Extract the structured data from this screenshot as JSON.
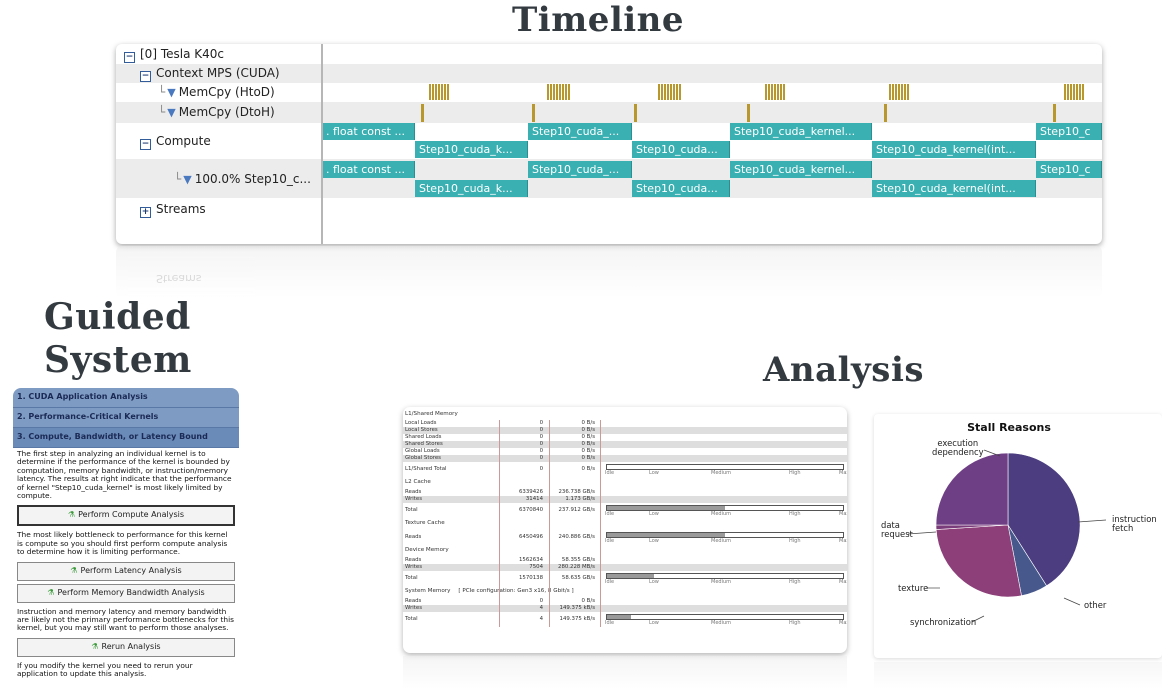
{
  "titles": {
    "timeline": "Timeline",
    "guided_line1": "Guided",
    "guided_line2": "System",
    "analysis": "Analysis"
  },
  "timeline": {
    "device": "[0] Tesla K40c",
    "context": "Context MPS (CUDA)",
    "memcpy_htod": "MemCpy (HtoD)",
    "memcpy_dtoh": "MemCpy (DtoH)",
    "compute": "Compute",
    "kernel_row": "100.0% Step10_c...",
    "streams": "Streams",
    "kernels_top": [
      ". float const ...",
      "Step10_cuda_...",
      "Step10_cuda_kernel...",
      "Step10_c"
    ],
    "kernels_bottom": [
      "Step10_cuda_k...",
      "Step10_cuda...",
      "Step10_cuda_kernel(int..."
    ]
  },
  "guided": {
    "sections": [
      "1. CUDA Application Analysis",
      "2. Performance-Critical Kernels",
      "3. Compute, Bandwidth, or Latency Bound"
    ],
    "intro": "The first step in analyzing an individual kernel is to determine if the performance of the kernel is bounded by computation, memory bandwidth, or instruction/memory latency. The results at right indicate that the performance of kernel \"Step10_cuda_kernel\" is most likely limited by compute.",
    "btn_compute": "Perform Compute Analysis",
    "compute_note": "The most likely bottleneck to performance for this kernel is compute so you should first perform compute analysis to determine how it is limiting performance.",
    "btn_latency": "Perform Latency Analysis",
    "btn_membw": "Perform Memory Bandwidth Analysis",
    "latency_note": "Instruction and memory latency and memory bandwidth are likely not the primary performance bottlenecks for this kernel, but you may still want to perform those analyses.",
    "btn_rerun": "Rerun Analysis",
    "rerun_note": "If you modify the kernel you need to rerun your application to update this analysis."
  },
  "metrics": {
    "sections": {
      "l1": "L1/Shared Memory",
      "l2": "L2 Cache",
      "tex": "Texture Cache",
      "dev": "Device Memory",
      "sys": "System Memory",
      "sys_note": "[ PCIe configuration: Gen3 x16, 8 Gbit/s ]"
    },
    "scale": [
      "Idle",
      "Low",
      "Medium",
      "High",
      "Max"
    ],
    "l1_rows": [
      {
        "name": "Local Loads",
        "count": "0",
        "rate": "0 B/s"
      },
      {
        "name": "Local Stores",
        "count": "0",
        "rate": "0 B/s"
      },
      {
        "name": "Shared Loads",
        "count": "0",
        "rate": "0 B/s"
      },
      {
        "name": "Shared Stores",
        "count": "0",
        "rate": "0 B/s"
      },
      {
        "name": "Global Loads",
        "count": "0",
        "rate": "0 B/s"
      },
      {
        "name": "Global Stores",
        "count": "0",
        "rate": "0 B/s"
      }
    ],
    "l1_total": {
      "name": "L1/Shared Total",
      "count": "0",
      "rate": "0 B/s",
      "level": 0.0
    },
    "l2_rows": [
      {
        "name": "Reads",
        "count": "6339426",
        "rate": "236.738 GB/s"
      },
      {
        "name": "Writes",
        "count": "31414",
        "rate": "1.173 GB/s"
      }
    ],
    "l2_total": {
      "name": "Total",
      "count": "6370840",
      "rate": "237.912 GB/s",
      "level": 0.5
    },
    "tex_reads": {
      "name": "Reads",
      "count": "6450496",
      "rate": "240.886 GB/s",
      "level": 0.5
    },
    "dev_rows": [
      {
        "name": "Reads",
        "count": "1562634",
        "rate": "58.355 GB/s"
      },
      {
        "name": "Writes",
        "count": "7504",
        "rate": "280.228 MB/s"
      }
    ],
    "dev_total": {
      "name": "Total",
      "count": "1570138",
      "rate": "58.635 GB/s",
      "level": 0.2
    },
    "sys_rows": [
      {
        "name": "Reads",
        "count": "0",
        "rate": "0 B/s"
      },
      {
        "name": "Writes",
        "count": "4",
        "rate": "149.375 kB/s"
      }
    ],
    "sys_total": {
      "name": "Total",
      "count": "4",
      "rate": "149.375 kB/s",
      "level": 0.1
    }
  },
  "stall": {
    "title": "Stall Reasons",
    "labels": {
      "execution_dependency": [
        "execution",
        "dependency"
      ],
      "instruction_fetch": [
        "instruction",
        "fetch"
      ],
      "data_request": [
        "data",
        "request"
      ],
      "texture": "texture",
      "other": "other",
      "synchronization": "synchronization"
    },
    "chart_data": {
      "type": "pie",
      "title": "Stall Reasons",
      "slices": [
        {
          "label": "execution dependency",
          "value": 0.41,
          "color": "#4b3d7f"
        },
        {
          "label": "instruction fetch",
          "value": 0.06,
          "color": "#46588c"
        },
        {
          "label": "other",
          "value": 0.27,
          "color": "#8c3f78"
        },
        {
          "label": "synchronization",
          "value": 0.01,
          "color": "#7a3c7a"
        },
        {
          "label": "texture",
          "value": 0.25,
          "color": "#6f3f86"
        },
        {
          "label": "data request",
          "value": 0.0,
          "color": "#5a4083"
        }
      ]
    }
  },
  "colors": {
    "kernel": "#3ab0b2",
    "memcpy": "#b8982c",
    "guided_header": "#7e9bc3"
  }
}
